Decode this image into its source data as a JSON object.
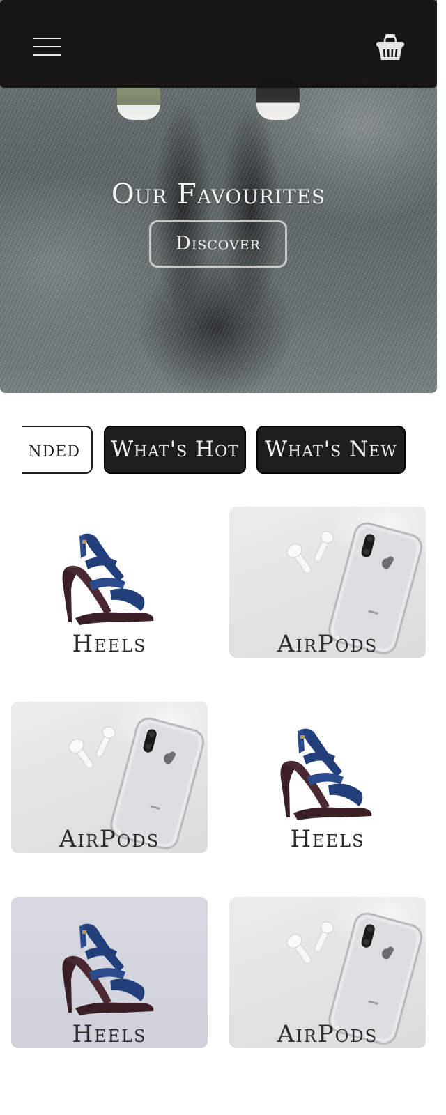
{
  "header": {
    "menu_icon": "hamburger-menu-icon",
    "cart_icon": "basket-icon"
  },
  "hero": {
    "title": "Our Favourites",
    "button_label": "Discover"
  },
  "tabs": [
    {
      "label": "Recommended",
      "visible_text": "nded",
      "active": false
    },
    {
      "label": "What's Hot",
      "active": true
    },
    {
      "label": "What's New",
      "active": true
    }
  ],
  "products": [
    {
      "label": "Heels",
      "image": "heels-icon"
    },
    {
      "label": "AirPods",
      "image": "airpods-iphone-icon"
    },
    {
      "label": "AirPods",
      "image": "airpods-iphone-icon"
    },
    {
      "label": "Heels",
      "image": "heels-icon"
    },
    {
      "label": "Heels",
      "image": "heels-icon"
    },
    {
      "label": "AirPods",
      "image": "airpods-iphone-icon"
    }
  ],
  "colors": {
    "topbar": "#111111",
    "tab_dark": "#1e1e1e",
    "heel_blue": "#233f7a",
    "heel_sole": "#3a1f24"
  }
}
